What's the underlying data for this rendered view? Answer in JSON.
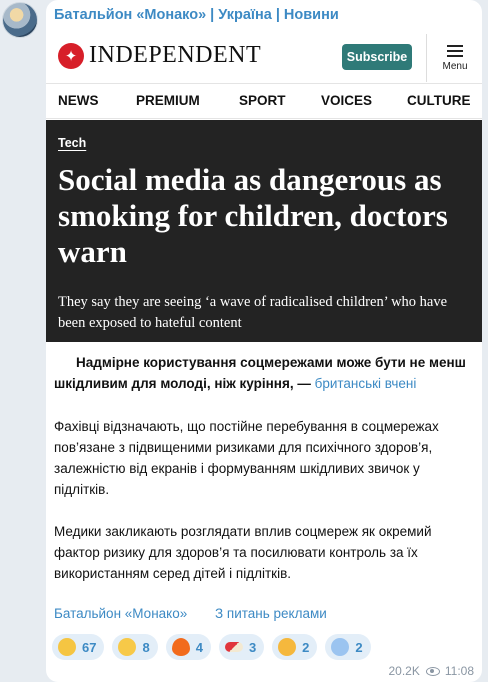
{
  "channel": {
    "title": "Батальйон «Монако» | Україна | Новини"
  },
  "article_preview": {
    "brand": "INDEPENDENT",
    "subscribe_label": "Subscribe",
    "menu_label": "Menu",
    "nav": [
      "NEWS",
      "PREMIUM",
      "SPORT",
      "VOICES",
      "CULTURE"
    ],
    "section_tag": "Tech",
    "headline": "Social media as dangerous as smoking for children, doctors warn",
    "standfirst": "They say they are seeing ‘a wave of radicalised children’ who have been exposed to hateful content"
  },
  "message": {
    "lead_bold": "Надмірне користування соцмережами може бути не менш шкідливим для молоді, ніж куріння, —",
    "lead_link": "британські вчені",
    "paragraph_2": "Фахівці відзначають, що постійне перебування в соцмережах пов’язане з підвищеними ризиками для психічного здоров’я, залежністю від екранів і формуванням шкідливих звичок у підлітків.",
    "paragraph_3": "Медики закликають розглядати вплив соцмереж як окремий фактор ризику для здоров’я та посилювати контроль за їх використанням серед дітей і підлітків."
  },
  "footer_links": {
    "channel_link": "Батальйон «Монако»",
    "ads_link": "З питань реклами"
  },
  "reactions": [
    {
      "icon": "thumbs-up-icon",
      "count": "67",
      "color": "#f5c542"
    },
    {
      "icon": "smiling-face-icon",
      "count": "8",
      "color": "#f7c948"
    },
    {
      "icon": "fire-icon",
      "count": "4",
      "color": "#f26b1d"
    },
    {
      "icon": "pill-icon",
      "count": "3",
      "color": "#e0353c"
    },
    {
      "icon": "hearts-face-icon",
      "count": "2",
      "color": "#f5b83d"
    },
    {
      "icon": "screaming-face-icon",
      "count": "2",
      "color": "#9bc4f0"
    }
  ],
  "meta": {
    "views": "20.2K",
    "time": "11:08"
  },
  "colors": {
    "link": "#3d8ac4",
    "subscribe": "#2f7a78",
    "logo_red": "#d71f29",
    "banner": "#232323"
  }
}
